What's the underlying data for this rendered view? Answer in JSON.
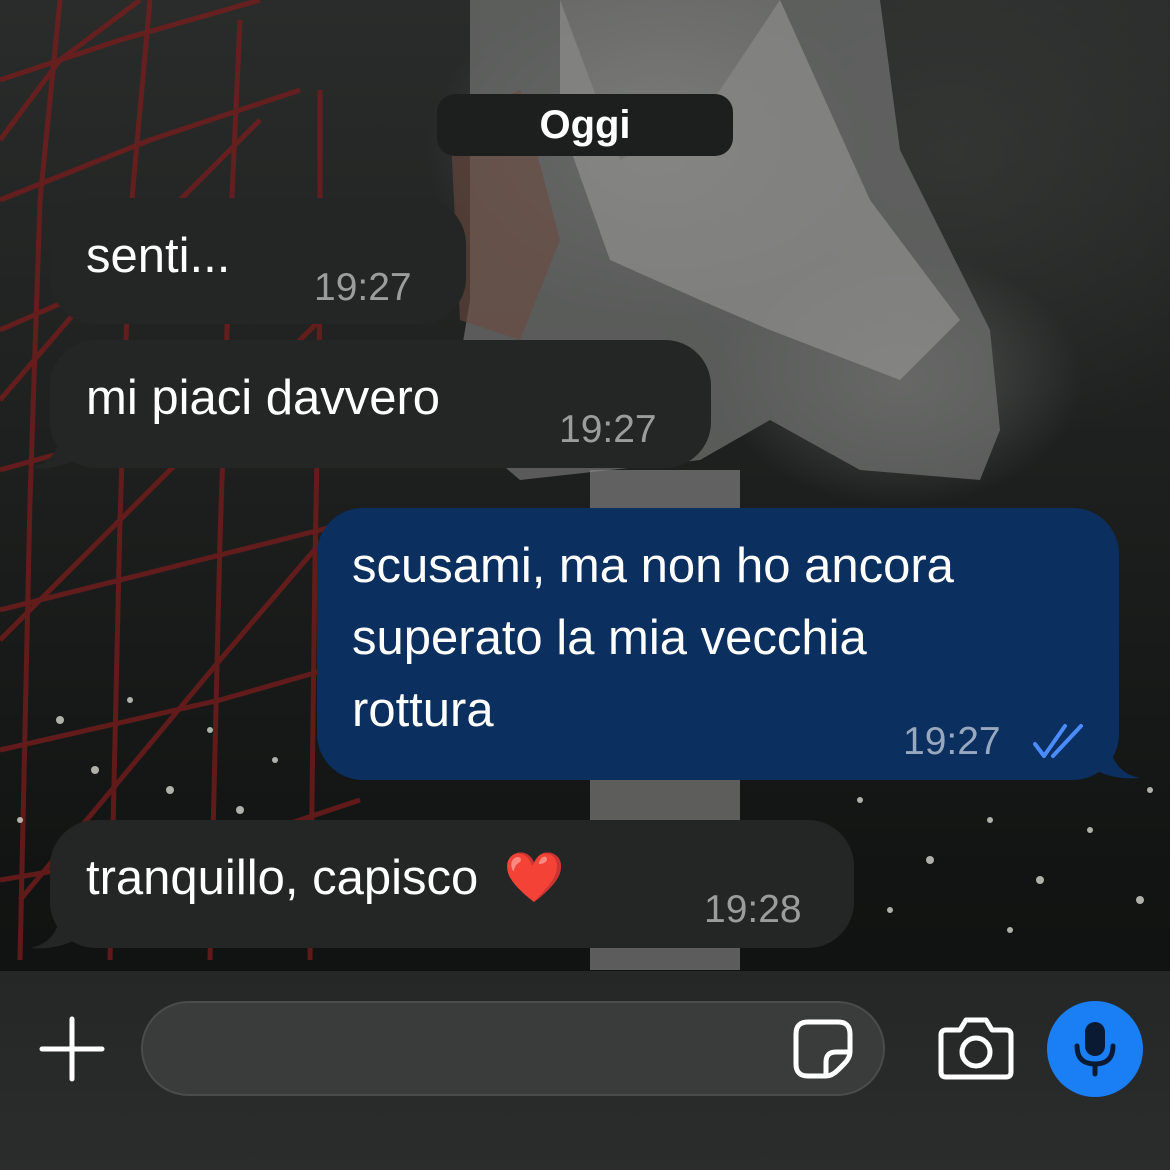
{
  "chat": {
    "date_label": "Oggi",
    "messages": [
      {
        "direction": "incoming",
        "text": "senti...",
        "time": "19:27"
      },
      {
        "direction": "incoming",
        "text": "mi piaci davvero",
        "time": "19:27"
      },
      {
        "direction": "outgoing",
        "lines": [
          "scusami, ma non ho ancora",
          "superato la mia vecchia",
          "rottura"
        ],
        "time": "19:27",
        "status": "read"
      },
      {
        "direction": "incoming",
        "text": "tranquillo, capisco",
        "emoji": "❤️",
        "time": "19:28"
      }
    ]
  },
  "composer": {
    "placeholder": "",
    "icons": {
      "attach": "plus-icon",
      "sticker": "sticker-icon",
      "camera": "camera-icon",
      "voice": "microphone-icon"
    }
  },
  "colors": {
    "incoming_bubble": "#242626",
    "outgoing_bubble": "#0b2f5f",
    "read_ticks": "#4a8cff",
    "mic_button": "#1a7ef5"
  }
}
